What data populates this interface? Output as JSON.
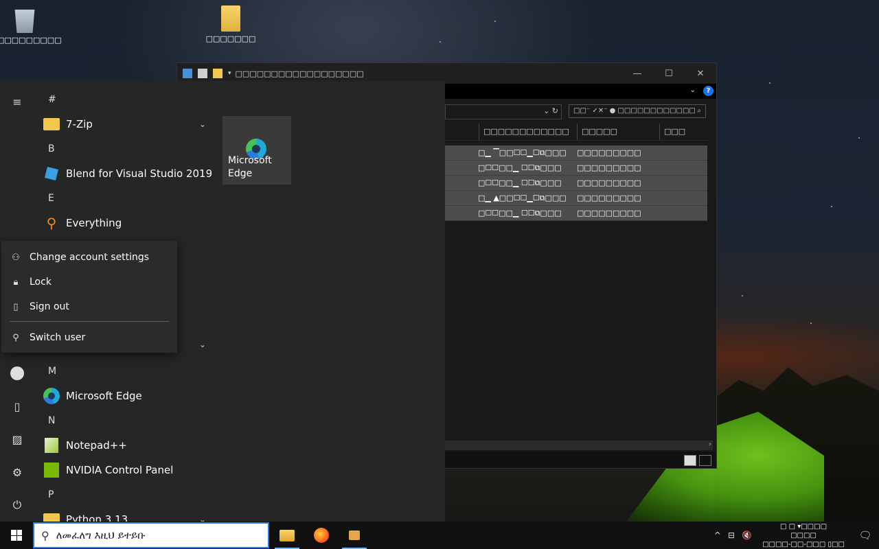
{
  "desktop": {
    "icons": [
      {
        "name": "recycle-bin",
        "label": "□□□□□□□□□"
      },
      {
        "name": "folder",
        "label": "□□□□□□□"
      }
    ]
  },
  "explorer": {
    "title": "□□□□□□□□□□□□□□□□□□",
    "controls": {
      "minimize": "—",
      "maximize": "☐",
      "close": "✕"
    },
    "ribbon_chevron": "⌄",
    "help": "?",
    "address_icons": "⌄ ↻",
    "search_placeholder": "□□⁻ ✓✕⁻ ● □□□□□□□□□□□□",
    "columns": [
      "□□□□□□□□□□□□",
      "□□□□□",
      "□□□"
    ],
    "rows": [
      [
        "□▁ ▔□□☐☐▁☐⧉□□□",
        "□□□□□□□□□"
      ],
      [
        "□☐☐□□▁ ☐☐⧉□□□",
        "□□□□□□□□□"
      ],
      [
        "□☐☐□□▁ ☐☐⧉□□□",
        "□□□□□□□□□"
      ],
      [
        "□▁ ▲□□☐☐▁☐⧉□□□",
        "□□□□□□□□□"
      ],
      [
        "□☐☐□□▁ ☐☐⧉□□□",
        "□□□□□□□□□"
      ]
    ],
    "scroll_arrow": "›"
  },
  "start_menu": {
    "letters": {
      "hash": "#",
      "b": "B",
      "e": "E",
      "m": "M",
      "n": "N",
      "p": "P"
    },
    "apps": {
      "zip": "7-Zip",
      "blend": "Blend for Visual Studio 2019",
      "everything": "Everything",
      "edge": "Microsoft Edge",
      "notepad": "Notepad++",
      "nvidia": "NVIDIA Control Panel",
      "python": "Python 3.13"
    },
    "tile_label": "Microsoft Edge",
    "account_menu": {
      "change_settings": "Change account settings",
      "lock": "Lock",
      "sign_out": "Sign out",
      "switch_user": "Switch user"
    }
  },
  "taskbar": {
    "search_placeholder": "ለመፈለግ እዚህ ይተይቡ",
    "clock_line1": "□ □ ▾□□□□",
    "clock_line2": "□□□□",
    "clock_line3": "□□□□-□□-□□□ ▯□□",
    "tray": {
      "chevron": "^",
      "network": "⊟",
      "volume": "🔇",
      "notifications": "🗨"
    }
  }
}
